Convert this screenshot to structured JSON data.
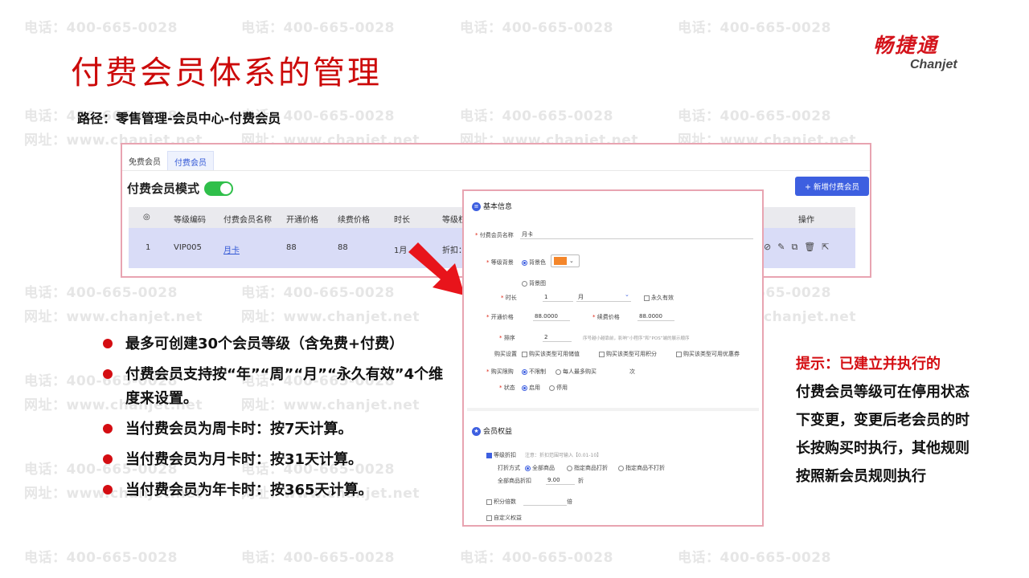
{
  "watermark": {
    "phone": "电话：400-665-0028",
    "site": "网址：www.chanjet.net"
  },
  "slide": {
    "title": "付费会员体系的管理"
  },
  "logo": {
    "cn": "畅捷通",
    "en": "Chanjet"
  },
  "path": "路径：零售管理-会员中心-付费会员",
  "screenshot": {
    "tabs": [
      "免费会员",
      "付费会员"
    ],
    "active_tab": "付费会员",
    "mode_label": "付费会员模式",
    "add_button": "+ 新增付费会员",
    "table": {
      "headers": [
        "◎",
        "等级编码",
        "付费会员名称",
        "开通价格",
        "续费价格",
        "时长",
        "等级权",
        "操作"
      ],
      "row": [
        "1",
        "VIP005",
        "月卡",
        "88",
        "88",
        "1月",
        "折扣："
      ]
    }
  },
  "popup": {
    "section_basic": "基本信息",
    "name_label": "付费会员名称",
    "name_value": "月卡",
    "level_bg_label": "等级背景",
    "bg_color": "背景色",
    "bg_image": "背景图",
    "duration_label": "时长",
    "duration_value": "1",
    "duration_unit": "月",
    "permanent": "永久有效",
    "open_price_label": "开通价格",
    "open_price_value": "88.0000",
    "renew_price_label": "续费价格",
    "renew_price_value": "88.0000",
    "sort_label": "排序",
    "sort_value": "2",
    "sort_hint": "序号越小越靠前，影响“小程序”和“POS”端的展示顺序",
    "buy_settings_label": "购买设置",
    "buy_opt1": "购买该类型可用储值",
    "buy_opt2": "购买该类型可用积分",
    "buy_opt3": "购买该类型可用优惠券",
    "buy_limit_label": "购买限购",
    "limit_opt1": "不限制",
    "limit_opt2": "每人最多购买",
    "limit_unit": "次",
    "status_label": "状态",
    "status_on": "启用",
    "status_off": "停用",
    "section_rights": "会员权益",
    "discount_label": "等级折扣",
    "discount_hint": "注意：折扣范围可输入【0.01-10】",
    "discount_mode_label": "打折方式",
    "mode_all": "全部商品",
    "mode_specific": "指定商品打折",
    "mode_exclude": "指定商品不打折",
    "all_discount_label": "全部商品折扣",
    "all_discount_value": "9.00",
    "discount_unit": "折",
    "points_label": "积分倍数",
    "points_unit": "倍",
    "custom_rights": "自定义权益"
  },
  "bullets": [
    "最多可创建30个会员等级（含免费+付费）",
    "付费会员支持按“年”“周”“月”“永久有效”4个维度来设置。",
    "当付费会员为周卡时：按7天计算。",
    "当付费会员为月卡时：按31天计算。",
    "当付费会员为年卡时：按365天计算。"
  ],
  "tip": {
    "title": "提示：已建立并执行的",
    "body": "付费会员等级可在停用状态下变更，变更后老会员的时长按购买时执行，其他规则按照新会员规则执行"
  },
  "colors": {
    "title_red": "#cc0a0a",
    "accent_blue": "#3d5fe0",
    "toggle_green": "#2fbf4a",
    "frame_pink": "#e8a4b1"
  }
}
